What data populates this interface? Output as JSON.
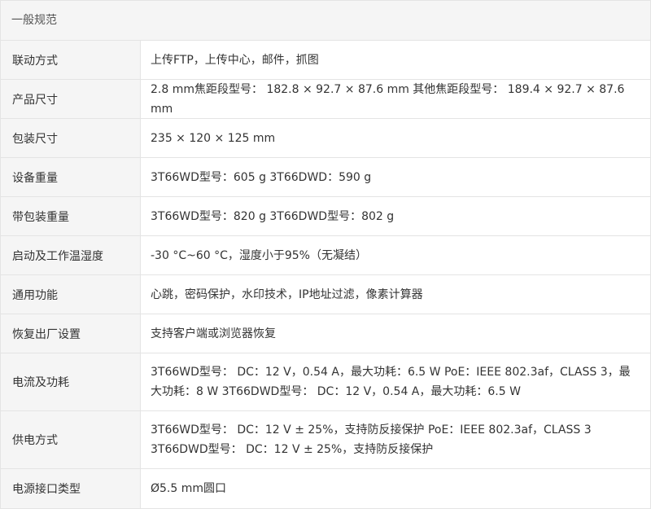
{
  "section": {
    "title": "一般规范"
  },
  "rows": [
    {
      "label": "联动方式",
      "value": "上传FTP，上传中心，邮件，抓图"
    },
    {
      "label": "产品尺寸",
      "value": "2.8 mm焦距段型号： 182.8 × 92.7 × 87.6 mm 其他焦距段型号： 189.4 × 92.7 × 87.6 mm"
    },
    {
      "label": "包装尺寸",
      "value": "235 × 120 × 125 mm"
    },
    {
      "label": "设备重量",
      "value": "3T66WD型号：605 g 3T66DWD：590 g"
    },
    {
      "label": "带包装重量",
      "value": "3T66WD型号：820 g 3T66DWD型号：802 g"
    },
    {
      "label": "启动及工作温湿度",
      "value": "-30 °C~60 °C，湿度小于95%（无凝结）"
    },
    {
      "label": "通用功能",
      "value": "心跳，密码保护，水印技术，IP地址过滤，像素计算器"
    },
    {
      "label": "恢复出厂设置",
      "value": "支持客户端或浏览器恢复"
    },
    {
      "label": "电流及功耗",
      "value": "3T66WD型号： DC：12 V，0.54 A，最大功耗：6.5 W PoE：IEEE 802.3af，CLASS 3，最大功耗：8 W 3T66DWD型号： DC：12 V，0.54 A，最大功耗：6.5 W"
    },
    {
      "label": "供电方式",
      "value": "3T66WD型号： DC：12 V ± 25%，支持防反接保护 PoE：IEEE 802.3af，CLASS 3 3T66DWD型号： DC：12 V ± 25%，支持防反接保护"
    },
    {
      "label": "电源接口类型",
      "value": "Ø5.5 mm圆口"
    }
  ]
}
